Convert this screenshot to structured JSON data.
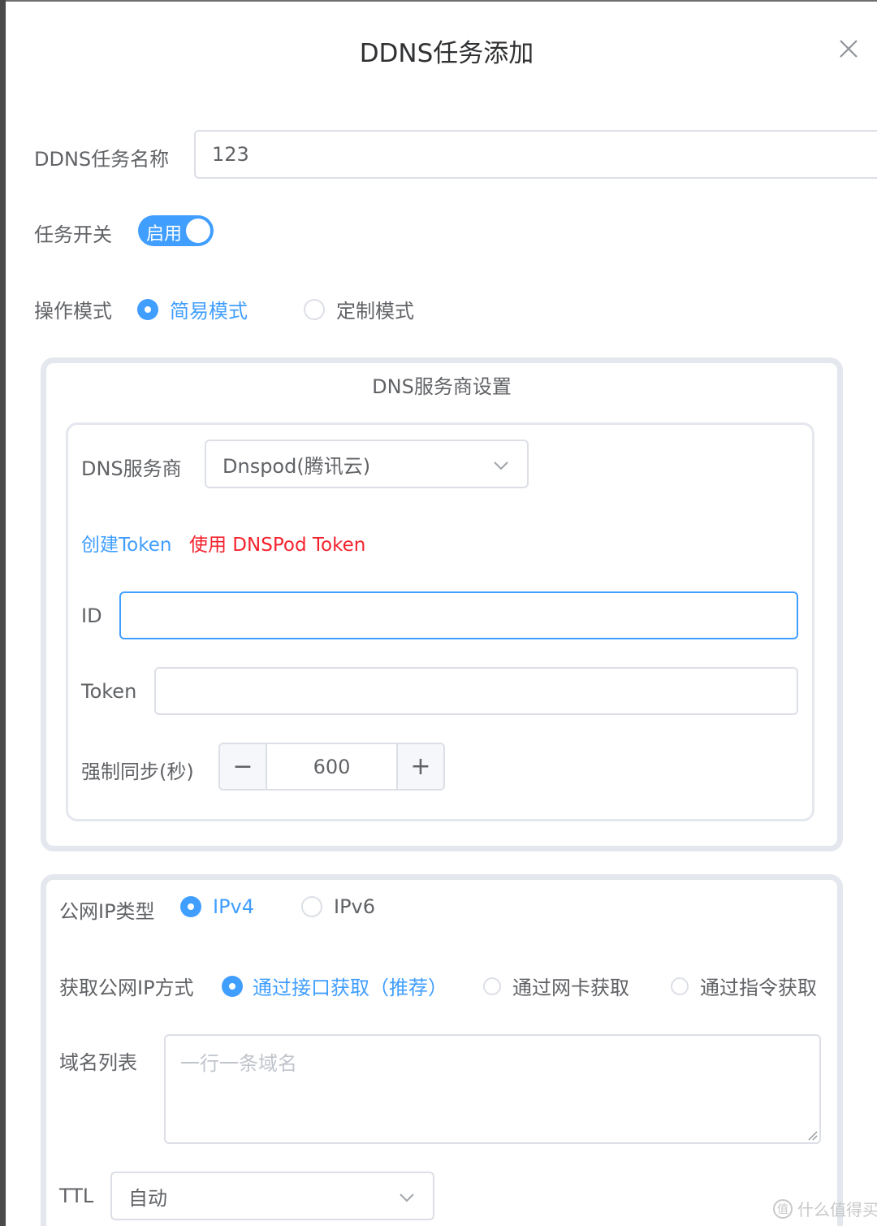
{
  "dialog": {
    "title": "DDNS任务添加"
  },
  "form": {
    "task_name_label": "DDNS任务名称",
    "task_name_value": "123",
    "task_switch_label": "任务开关",
    "task_switch_text": "启用",
    "mode_label": "操作模式",
    "mode_options": [
      "简易模式",
      "定制模式"
    ],
    "mode_selected": "简易模式"
  },
  "dns_panel": {
    "title": "DNS服务商设置",
    "provider_label": "DNS服务商",
    "provider_value": "Dnspod(腾讯云)",
    "create_token_link": "创建Token",
    "use_token_link": "使用 DNSPod Token",
    "id_label": "ID",
    "id_value": "",
    "token_label": "Token",
    "token_value": "",
    "sync_label": "强制同步(秒)",
    "sync_value": "600",
    "minus": "−",
    "plus": "+"
  },
  "ip_panel": {
    "ip_type_label": "公网IP类型",
    "ip_type_options": [
      "IPv4",
      "IPv6"
    ],
    "ip_type_selected": "IPv4",
    "ip_method_label": "获取公网IP方式",
    "ip_method_options": [
      "通过接口获取（推荐）",
      "通过网卡获取",
      "通过指令获取"
    ],
    "ip_method_selected": "通过接口获取（推荐）",
    "domains_label": "域名列表",
    "domains_placeholder": "一行一条域名",
    "ttl_label": "TTL",
    "ttl_value": "自动"
  },
  "watermark": {
    "text": "什么值得买",
    "logo_text": "值"
  },
  "colors": {
    "accent": "#409eff",
    "danger": "#f5222d",
    "border": "#dcdfe6",
    "panel_border": "#e4e7ed"
  }
}
